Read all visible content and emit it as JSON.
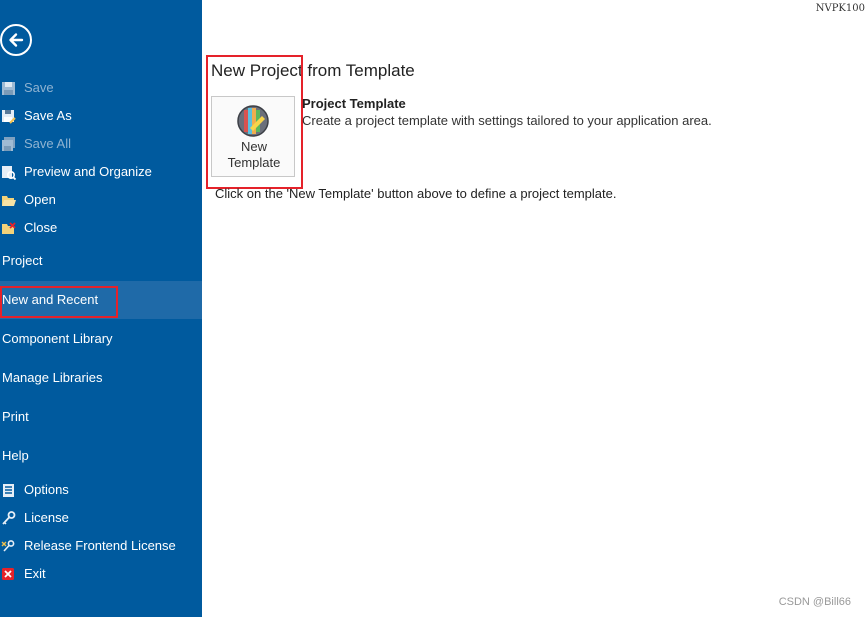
{
  "header": {
    "machine_id": "NVPK100"
  },
  "sidebar": {
    "back_icon": "arrow-left-circle-icon",
    "file_items": [
      {
        "label": "Save",
        "icon": "floppy-disk-icon",
        "disabled": true
      },
      {
        "label": "Save As",
        "icon": "floppy-disk-edit-icon",
        "disabled": false
      },
      {
        "label": "Save All",
        "icon": "floppy-disks-icon",
        "disabled": true
      },
      {
        "label": "Preview and Organize",
        "icon": "preview-organize-icon",
        "disabled": false
      },
      {
        "label": "Open",
        "icon": "folder-open-icon",
        "disabled": false
      },
      {
        "label": "Close",
        "icon": "folder-close-icon",
        "disabled": false
      }
    ],
    "sections": [
      {
        "label": "Project",
        "active": false
      },
      {
        "label": "New and Recent",
        "active": true
      },
      {
        "label": "Component Library",
        "active": false
      },
      {
        "label": "Manage Libraries",
        "active": false
      },
      {
        "label": "Print",
        "active": false
      },
      {
        "label": "Help",
        "active": false
      }
    ],
    "bottom_items": [
      {
        "label": "Options",
        "icon": "options-list-icon"
      },
      {
        "label": "License",
        "icon": "key-icon"
      },
      {
        "label": "Release Frontend License",
        "icon": "release-license-icon"
      },
      {
        "label": "Exit",
        "icon": "exit-x-icon"
      }
    ]
  },
  "main": {
    "title": "New Project from Template",
    "template_button": {
      "line1": "New",
      "line2": "Template",
      "icon": "new-template-icon"
    },
    "template_name": "Project Template",
    "template_description": "Create a project template with settings tailored to your application area.",
    "instruction": "Click on the 'New Template' button above to define a project template."
  },
  "watermark": "CSDN @Bill66",
  "colors": {
    "sidebar_bg": "#005a9e",
    "sidebar_active_bg": "#1f6aa8",
    "highlight_border": "#e5222a",
    "disabled_text": "#8fb3d1"
  }
}
